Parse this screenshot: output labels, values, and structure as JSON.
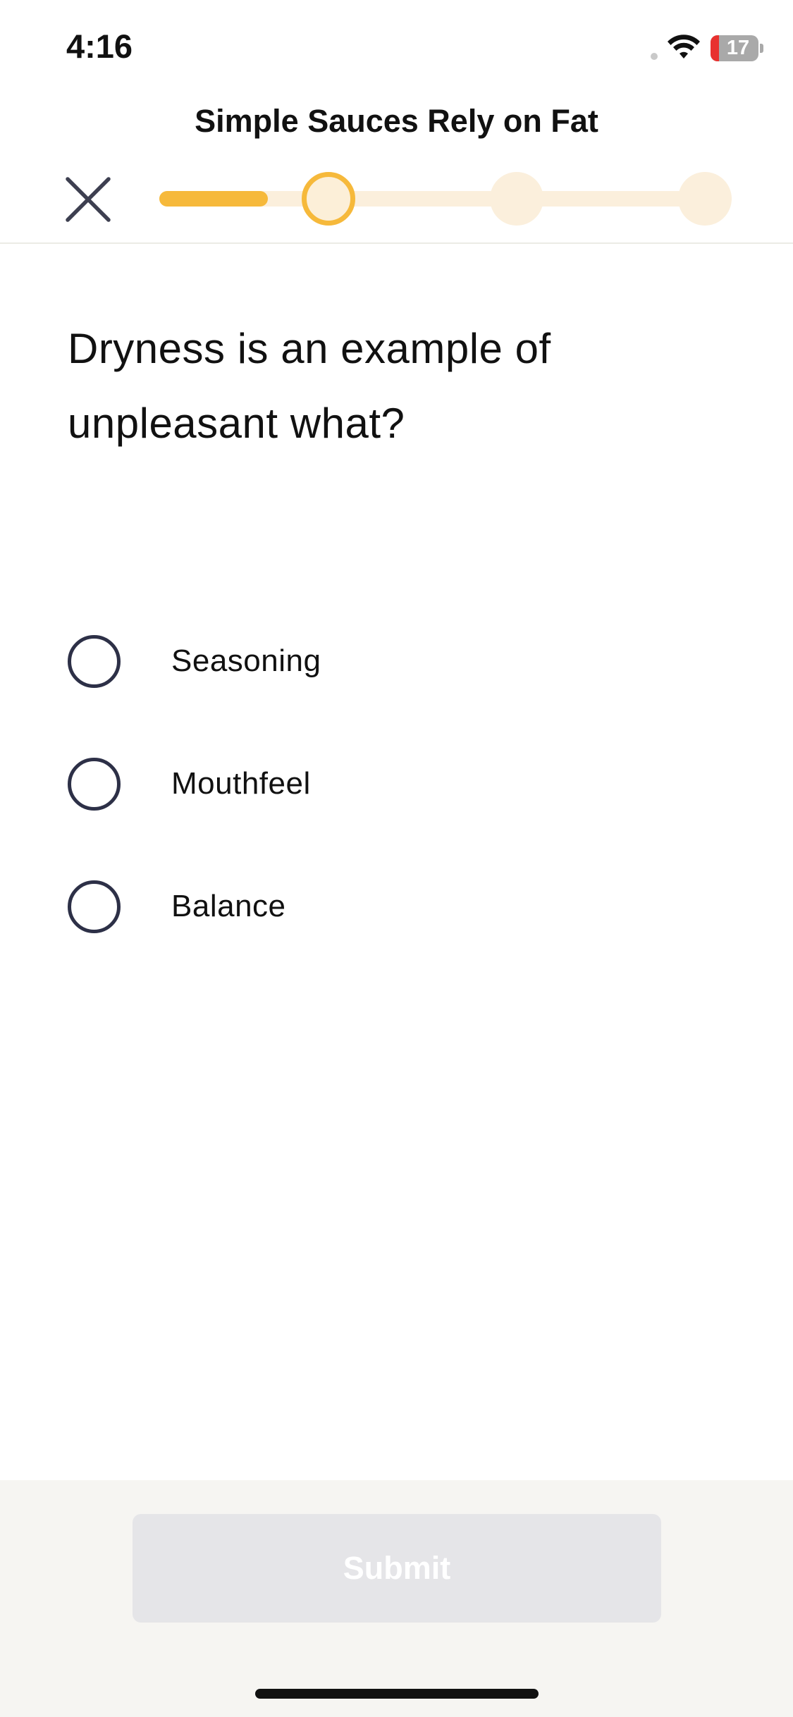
{
  "status_bar": {
    "time": "4:16",
    "battery_level": "17",
    "icons": [
      "wifi-icon",
      "battery-icon"
    ],
    "battery_color": "#a9a9a9",
    "battery_low_color": "#e8312f"
  },
  "header": {
    "title": "Simple Sauces Rely on Fat",
    "close_icon": "close-icon",
    "progress": {
      "total_steps": 4,
      "current_step": 2,
      "fill_fraction": 0.19,
      "accent_color": "#f6b93b",
      "track_color": "#fbefdc"
    }
  },
  "question": {
    "text": "Dryness is an example of unpleasant what?"
  },
  "options": [
    {
      "label": "Seasoning",
      "selected": false
    },
    {
      "label": "Mouthfeel",
      "selected": false
    },
    {
      "label": "Balance",
      "selected": false
    }
  ],
  "footer": {
    "submit_label": "Submit",
    "submit_enabled": false
  }
}
